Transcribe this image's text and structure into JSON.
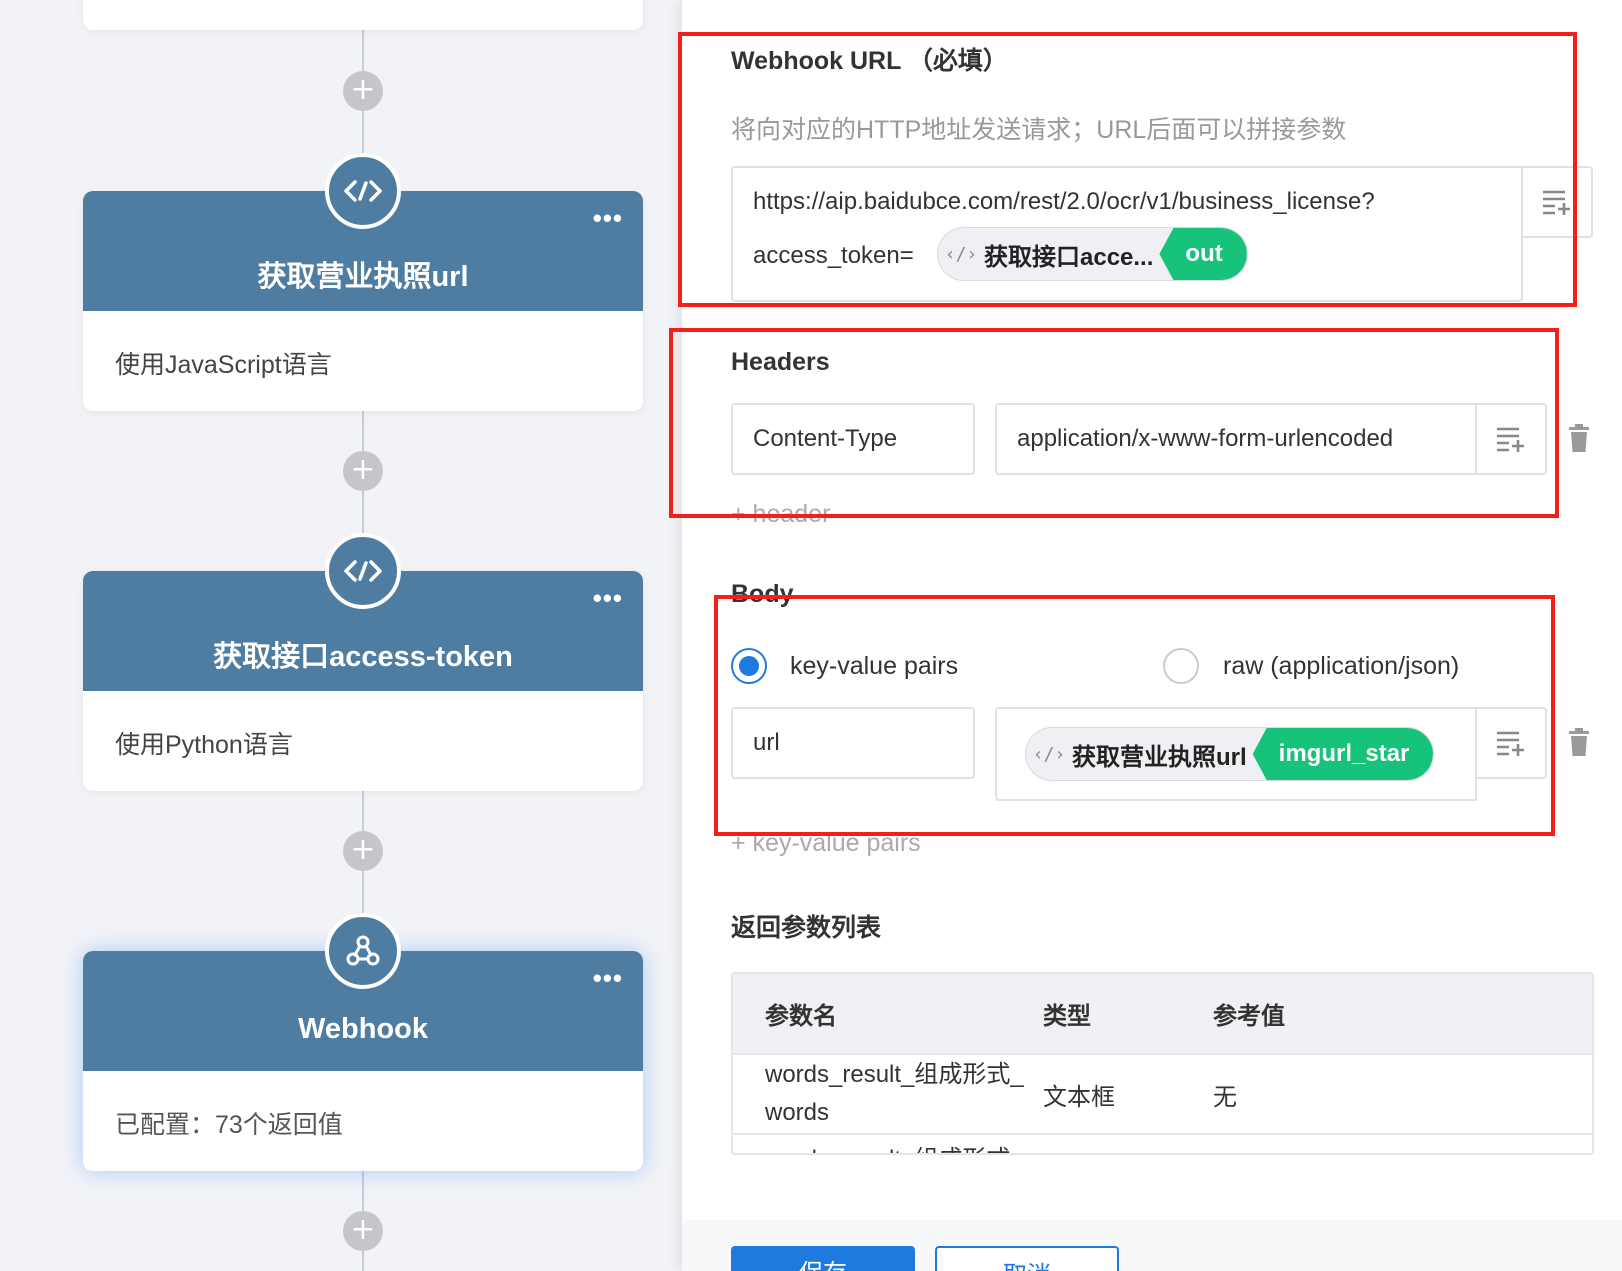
{
  "flow": {
    "nodes": [
      {
        "title": "获取营业执照url",
        "desc": "使用JavaScript语言",
        "icon": "code-icon"
      },
      {
        "title": "获取接口access-token",
        "desc": "使用Python语言",
        "icon": "code-icon"
      },
      {
        "title": "Webhook",
        "desc": "已配置：73个返回值",
        "icon": "webhook-icon"
      }
    ],
    "more_label": "•••",
    "add_label": "+"
  },
  "panel": {
    "url_section": {
      "title": "Webhook URL （必填）",
      "hint": "将向对应的HTTP地址发送请求；URL后面可以拼接参数",
      "value_line1": "https://aip.baidubce.com/rest/2.0/ocr/v1/business_license?",
      "value_prefix": "access_token=",
      "chip_name": "获取接口acce...",
      "chip_out": "out"
    },
    "headers_section": {
      "title": "Headers",
      "key": "Content-Type",
      "value": "application/x-www-form-urlencoded",
      "add_label": "+ header"
    },
    "body_section": {
      "title": "Body",
      "option_kv": "key-value pairs",
      "option_raw": "raw (application/json)",
      "selected": "key-value pairs",
      "key": "url",
      "chip_name": "获取营业执照url",
      "chip_out": "imgurl_star",
      "add_label": "+ key-value pairs"
    },
    "return_section": {
      "title": "返回参数列表",
      "columns": [
        "参数名",
        "类型",
        "参考值"
      ],
      "rows": [
        [
          "words_result_组成形式_words",
          "文本框",
          "无"
        ],
        [
          "words_result_组成形式",
          "",
          ""
        ]
      ]
    },
    "footer": {
      "save_label": "保存",
      "cancel_label": "取消"
    }
  },
  "colors": {
    "node_header": "#4e7da1",
    "chip_green": "#17c27a",
    "highlight_red": "#f0201b",
    "primary_blue": "#1f7ae0"
  }
}
